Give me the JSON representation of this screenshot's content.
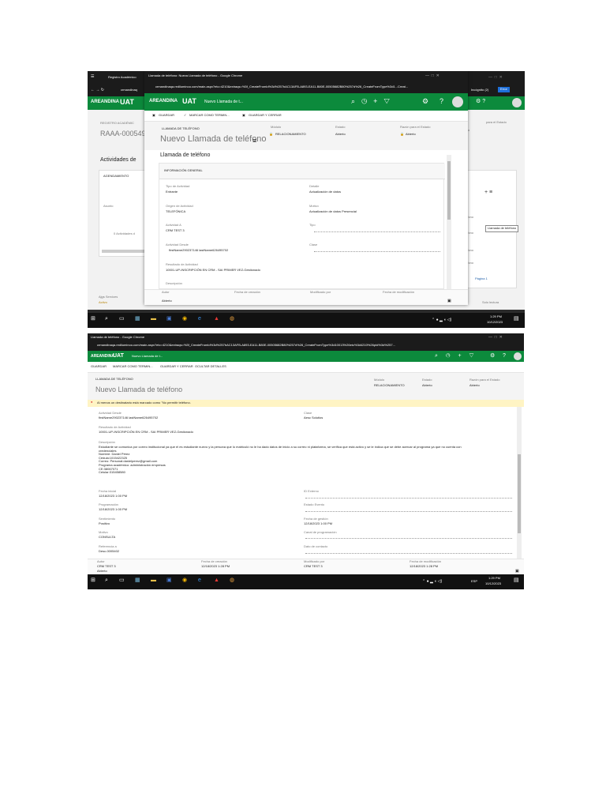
{
  "shot1": {
    "bg_tab": "Registro Académico",
    "bg_tab2": "crmandinaq",
    "incognito": "Incógnito (2)",
    "error": "Error",
    "bg_logo": "AREANDINA",
    "bg_uat": "UAT",
    "bg_header": "REGISTRO ACADÉMIC",
    "bg_record": "RAAA-000549",
    "bg_section": "Actividades de",
    "bg_agend": "AGENDAMIENTO",
    "bg_asunto": "Asunto",
    "bg_no_act": "0 Actividades d",
    "bg_right_label": "para el Estado",
    "bg_right_o": "o",
    "bg_right_rows": [
      "afono",
      "afono",
      "afono",
      "afono"
    ],
    "bg_row_d": "d",
    "tooltip": "Llamada de teléfono",
    "pagina": "Página 1",
    "solo_lectura": "Solo lectura",
    "bg_footer": [
      "Autor",
      "Ajgs Services",
      "Activo"
    ],
    "popup_title": "Llamada de teléfono: Nueva Llamada de teléfono - Google Chrome",
    "popup_url": "crmandinaqa.rediluminoo.com/main.aspx?etc=4210&extraqs=%3f_CreateFromId%3d%257bAC13AFB-A893-EA11-B80E-00505682B80%257d%26_CreateFromType%3d1...Creat...",
    "logo": "AREANDINA",
    "uat": "UAT",
    "nav_title": "Nuevo Llamada de t...",
    "cmd_save": "GUARDAR",
    "cmd_mark": "MARCAR COMO TERMIN...",
    "cmd_save_close": "GUARDAR Y CERRAR",
    "entity": "LLAMADA DE TELÉFONO",
    "record_title": "Nuevo Llamada de teléfono",
    "hdr_modulo_label": "Módulo",
    "hdr_modulo_value": "RELACIONAMIENTO",
    "hdr_estado_label": "Estado",
    "hdr_estado_value": "Abierto",
    "hdr_razon_label": "Razón para el Estado",
    "hdr_razon_value": "Abierto",
    "section": "Llamada de teléfono",
    "tab_general": "INFORMACIÓN GENERAL",
    "tipo_label": "Tipo de Actividad",
    "tipo_value": "Entrante",
    "detalle_label": "Detalle",
    "detalle_value": "Actualización de datos",
    "origen_label": "Origen de Actividad",
    "origen_value": "TELEFÓNICA",
    "motivo_label": "Motivo",
    "motivo_value": "Actualización de datos Presencial",
    "actividad_a_label": "Actividad A",
    "actividad_a_value": "CRM TEST 3",
    "tipo2_label": "Tipo",
    "desde_label": "Actividad Desde",
    "desde_value": "firstName290237146 lastName626495702",
    "clase_label": "Clase",
    "resultado_label": "Resultado de Actividad",
    "resultado_value": "10001-UP-INSCRIPCIÓN EN CRM - SAI PRIMER VEZ-Gestionado",
    "descripcion_label": "Descripción",
    "footer_autor": "Autor",
    "footer_fecha": "Fecha de creación",
    "footer_modificado": "Modificado por",
    "footer_fecha_mod": "Fecha de modificación",
    "status": "Abierto",
    "time": "1:29 PM",
    "date": "10/12/2023"
  },
  "shot2": {
    "window_title": "Llamada de teléfono - Google Chrome",
    "url": "crmandinaqa.rediluminoo.com/main.aspx?etc=4210&extraqs=%3f_CreateFromId%3d%257bAC13AFB-A893-EA11-B80E-00505682B80%257d%26_CreateFromType%3d10013%26etc%3d4210%26pId%3d%257...",
    "logo": "AREANDINA",
    "uat": "UAT",
    "nav_title": "Nuevo Llamada de t...",
    "cmd_save": "GUARDAR",
    "cmd_mark": "MARCAR COMO TERMIN...",
    "cmd_save_close": "GUARDAR Y CERRAR",
    "cmd_ocultar": "OCULTAR DETALLES",
    "entity": "LLAMADA DE TELÉFONO",
    "record_title": "Nuevo Llamada de teléfono",
    "hdr_modulo_label": "Módulo",
    "hdr_modulo_value": "RELACIONAMIENTO",
    "hdr_estado_label": "Estado",
    "hdr_estado_value": "Abierto",
    "hdr_razon_label": "Razón para el Estado",
    "hdr_razon_value": "Abierto",
    "warning": "Al menos un destinatario está marcado como \"No permitir teléfono.",
    "desde_label": "Actividad Desde",
    "desde_value": "firstName290237146 lastName626495702",
    "clase_label": "Clase",
    "clase_value": "Aesc Solutios",
    "resultado_label": "Resultado de Actividad",
    "resultado_value": "10001-UP-INSCRIPCIÓN EN CRM - SAI PRIMER VEZ-Gestionado",
    "descripcion_label": "Descripción",
    "descripcion_lines": [
      "Estudiante se comunica por correo institucional ya que el es estudiante nuevo y la persona que lo matriculó no le ha dado datos de inicio a su correo ni plataforma, se verifica que está activo y se le indica que se debe acercar al programa ya que no cuenta con",
      "credenciales",
      "Nombre: Daniel Pérez",
      "Cédula:1015422325",
      "Correo: Personal:danielperez@gmail.com",
      "Programa académico: administración empresas",
      "CE:38067071",
      "Celular:315458580"
    ],
    "fecha_inicial_label": "Fecha inicial",
    "fecha_inicial_value": "12/18/2023 1:00 PM",
    "id_externo_label": "ID Externo",
    "programacion_label": "Programación",
    "programacion_value": "12/18/2023 1:00 PM",
    "estado_evento_label": "Estado Evento",
    "sentimiento_label": "Sentimiento",
    "sentimiento_value": "Positivo",
    "fecha_gestion_label": "Fecha de gestión",
    "fecha_gestion_value": "12/18/2023 1:00 PM",
    "motivo_label": "Motivo",
    "motivo_value": "CONSULTA",
    "canal_label": "Canal de programación",
    "referencia_label": "Referencia a",
    "referencia_value": "Desc-0005402",
    "dato_contacto_label": "Dato de contacto",
    "footer_autor": "Autor",
    "footer_autor_value": "CRM TEST 3",
    "footer_fecha": "Fecha de creación",
    "footer_fecha_value": "12/18/2023 1:28 PM",
    "footer_modificado": "Modificado por",
    "footer_modificado_value": "CRM TEST 3",
    "footer_fecha_mod": "Fecha de modificación",
    "footer_fecha_mod_value": "12/18/2023 1:28 PM",
    "status": "Abierto",
    "esp": "ESP",
    "time": "1:29 PM",
    "date": "10/12/2023"
  },
  "colors": {
    "crm_green": "#0c8a3c",
    "taskbar": "#111111",
    "warning": "#fff4c4"
  }
}
